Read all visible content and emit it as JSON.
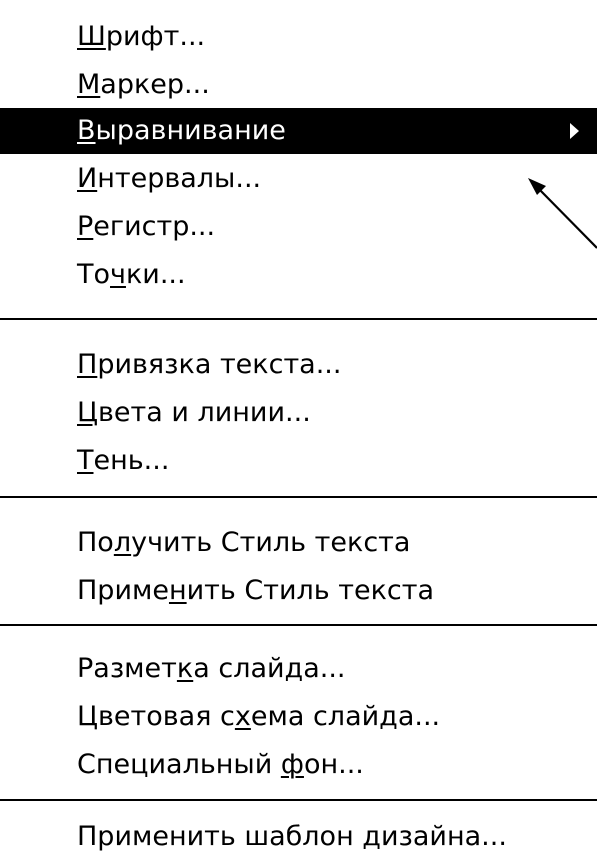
{
  "menu": {
    "items": [
      {
        "pre": "",
        "ul": "Ш",
        "post": "рифт..."
      },
      {
        "pre": "",
        "ul": "М",
        "post": "аркер..."
      },
      {
        "pre": "",
        "ul": "В",
        "post": "ыравнивание"
      },
      {
        "pre": "",
        "ul": "И",
        "post": "нтервалы..."
      },
      {
        "pre": "",
        "ul": "Р",
        "post": "егистр..."
      },
      {
        "pre": "То",
        "ul": "ч",
        "post": "ки..."
      },
      {
        "pre": "",
        "ul": "П",
        "post": "ривязка текста..."
      },
      {
        "pre": "",
        "ul": "Ц",
        "post": "вета и линии..."
      },
      {
        "pre": "",
        "ul": "Т",
        "post": "ень..."
      },
      {
        "pre": "По",
        "ul": "л",
        "post": "учить Стиль текста"
      },
      {
        "pre": "Приме",
        "ul": "н",
        "post": "ить Стиль текста"
      },
      {
        "pre": "Размет",
        "ul": "к",
        "post": "а слайда..."
      },
      {
        "pre": "Цветовая с",
        "ul": "х",
        "post": "ема слайда..."
      },
      {
        "pre": "Специальный ",
        "ul": "ф",
        "post": "он..."
      },
      {
        "pre": "Применить шаблон дизайна...",
        "ul": "",
        "post": ""
      }
    ],
    "highlighted_item": "Выравнивание",
    "submenu_indicator": "right-triangle",
    "colors": {
      "background": "#ffffff",
      "text": "#000000",
      "highlight_background": "#000000",
      "highlight_text": "#ffffff"
    }
  },
  "annotation": {
    "icon": "arrow-pointer"
  }
}
